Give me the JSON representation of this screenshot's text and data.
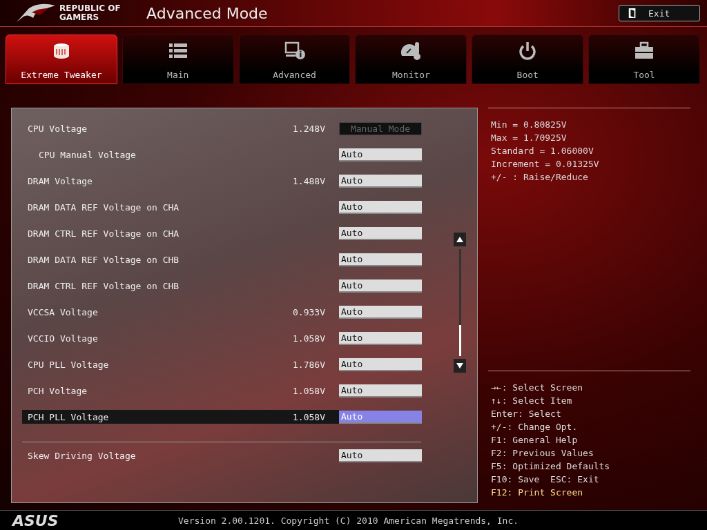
{
  "header": {
    "brand_line_1": "REPUBLIC OF",
    "brand_line_2": "GAMERS",
    "title": "Advanced Mode",
    "exit_label": "Exit"
  },
  "tabs": [
    {
      "label": "Extreme Tweaker",
      "selected": true
    },
    {
      "label": "Main",
      "selected": false
    },
    {
      "label": "Advanced",
      "selected": false
    },
    {
      "label": "Monitor",
      "selected": false
    },
    {
      "label": "Boot",
      "selected": false
    },
    {
      "label": "Tool",
      "selected": false
    }
  ],
  "settings": [
    {
      "label": "CPU Voltage",
      "reading": "1.248V",
      "value": "Manual Mode",
      "kind": "mode",
      "selected": false,
      "children": [
        {
          "label": "CPU Manual Voltage",
          "value": "Auto",
          "kind": "field",
          "selected": false
        }
      ]
    },
    {
      "label": "DRAM Voltage",
      "reading": "1.488V",
      "value": "Auto",
      "kind": "field",
      "selected": false
    },
    {
      "label": "DRAM DATA REF Voltage on CHA",
      "value": "Auto",
      "kind": "field",
      "selected": false
    },
    {
      "label": "DRAM CTRL REF Voltage on CHA",
      "value": "Auto",
      "kind": "field",
      "selected": false
    },
    {
      "label": "DRAM DATA REF Voltage on CHB",
      "value": "Auto",
      "kind": "field",
      "selected": false
    },
    {
      "label": "DRAM CTRL REF Voltage on CHB",
      "value": "Auto",
      "kind": "field",
      "selected": false
    },
    {
      "label": "VCCSA Voltage",
      "reading": "0.933V",
      "value": "Auto",
      "kind": "field",
      "selected": false
    },
    {
      "label": "VCCIO Voltage",
      "reading": "1.058V",
      "value": "Auto",
      "kind": "field",
      "selected": false
    },
    {
      "label": "CPU PLL Voltage",
      "reading": "1.786V",
      "value": "Auto",
      "kind": "field",
      "selected": false
    },
    {
      "label": "PCH Voltage",
      "reading": "1.058V",
      "value": "Auto",
      "kind": "field",
      "selected": false
    },
    {
      "label": "PCH PLL Voltage",
      "reading": "1.058V",
      "value": "Auto",
      "kind": "field",
      "selected": true
    }
  ],
  "extra_settings": [
    {
      "label": "Skew Driving Voltage",
      "value": "Auto",
      "kind": "field",
      "selected": false
    }
  ],
  "info": [
    "Min = 0.80825V",
    "Max = 1.70925V",
    "Standard = 1.06000V",
    "Increment = 0.01325V",
    "+/- : Raise/Reduce"
  ],
  "help": [
    {
      "text": "→←: Select Screen",
      "highlighted": false
    },
    {
      "text": "↑↓: Select Item",
      "highlighted": false
    },
    {
      "text": "Enter: Select",
      "highlighted": false
    },
    {
      "text": "+/-: Change Opt.",
      "highlighted": false
    },
    {
      "text": "F1: General Help",
      "highlighted": false
    },
    {
      "text": "F2: Previous Values",
      "highlighted": false
    },
    {
      "text": "F5: Optimized Defaults",
      "highlighted": false
    },
    {
      "text": "F10: Save  ESC: Exit",
      "highlighted": false
    },
    {
      "text": "F12: Print Screen",
      "highlighted": true
    }
  ],
  "footer": {
    "brand": "ASUS",
    "version": "Version 2.00.1201. Copyright (C) 2010 American Megatrends, Inc."
  }
}
